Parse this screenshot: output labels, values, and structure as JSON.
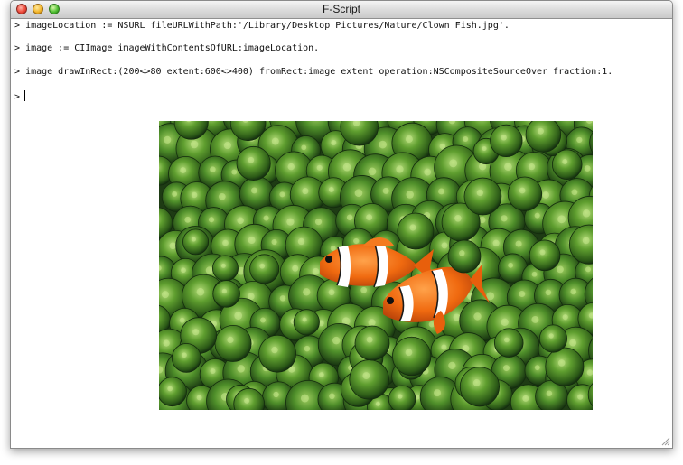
{
  "window": {
    "title": "F-Script"
  },
  "console": {
    "prompt": ">",
    "lines": [
      "imageLocation := NSURL fileURLWithPath:'/Library/Desktop Pictures/Nature/Clown Fish.jpg'.",
      "image := CIImage imageWithContentsOfURL:imageLocation.",
      "image drawInRect:(200<>80 extent:600<>400) fromRect:image extent operation:NSCompositeSourceOver fraction:1."
    ],
    "current_input": ""
  },
  "image": {
    "subject": "clown fish among green sea anemone",
    "colors": {
      "anemone": "#4f8f2a",
      "anemone_dark": "#1e3b14",
      "fish": "#f06a10"
    }
  },
  "icons": {
    "close": "close-button-icon",
    "minimize": "minimize-button-icon",
    "zoom": "zoom-button-icon",
    "resize": "resize-grip-icon"
  }
}
